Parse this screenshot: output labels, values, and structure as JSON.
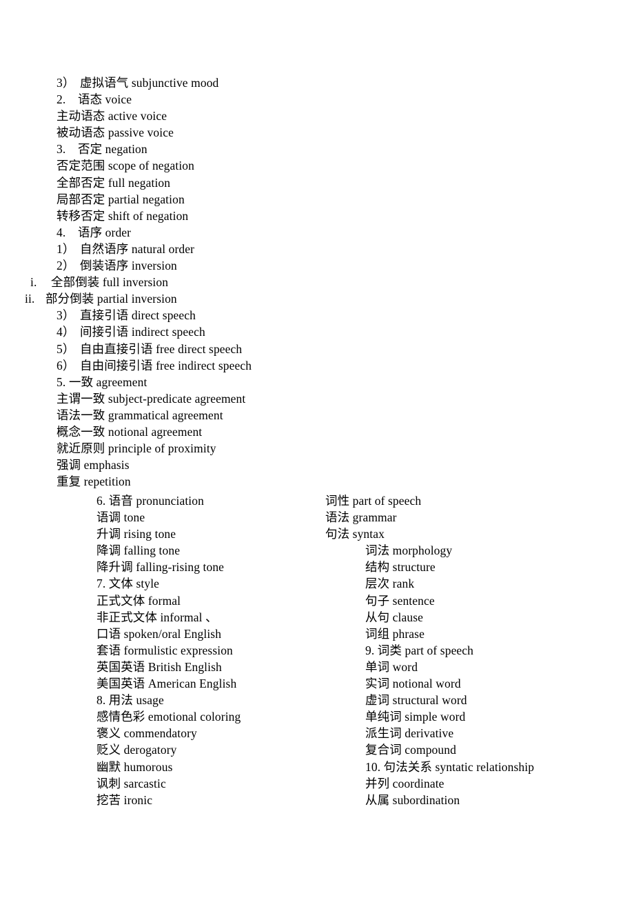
{
  "document": {
    "title": "Grammar Terminology Outline",
    "page_background": "#ffffff",
    "text_color": "#000000"
  },
  "outline_top": [
    {
      "marker": "3）",
      "text": "虚拟语气 subjunctive mood",
      "indent": "paren"
    },
    {
      "marker": "2.",
      "text": "语态 voice",
      "indent": "num"
    },
    {
      "marker": "",
      "text": "主动语态 active voice",
      "indent": "plain"
    },
    {
      "marker": "",
      "text": "被动语态 passive voice",
      "indent": "plain"
    },
    {
      "marker": "3.",
      "text": "否定 negation",
      "indent": "num"
    },
    {
      "marker": "",
      "text": "否定范围 scope of negation",
      "indent": "plain"
    },
    {
      "marker": "",
      "text": "全部否定 full negation",
      "indent": "plain"
    },
    {
      "marker": "",
      "text": "局部否定 partial negation",
      "indent": "plain"
    },
    {
      "marker": "",
      "text": "转移否定 shift of negation",
      "indent": "plain"
    },
    {
      "marker": "4.",
      "text": "语序 order",
      "indent": "num"
    },
    {
      "marker": "1）",
      "text": "自然语序 natural order",
      "indent": "paren"
    },
    {
      "marker": "2）",
      "text": "倒装语序 inversion",
      "indent": "paren"
    },
    {
      "marker": "i.",
      "text": "全部倒装 full inversion",
      "indent": "roman-i"
    },
    {
      "marker": "ii.",
      "text": "部分倒装 partial inversion",
      "indent": "roman-ii"
    },
    {
      "marker": "3）",
      "text": "直接引语 direct speech",
      "indent": "paren"
    },
    {
      "marker": "4）",
      "text": "间接引语 indirect speech",
      "indent": "paren"
    },
    {
      "marker": "5）",
      "text": "自由直接引语 free direct speech",
      "indent": "paren"
    },
    {
      "marker": "6）",
      "text": "自由间接引语 free indirect speech",
      "indent": "paren"
    },
    {
      "marker": "5.",
      "text": "一致 agreement",
      "indent": "num-tight"
    },
    {
      "marker": "",
      "text": "主谓一致 subject-predicate agreement",
      "indent": "plain"
    },
    {
      "marker": "",
      "text": "语法一致 grammatical agreement",
      "indent": "plain"
    },
    {
      "marker": "",
      "text": "概念一致 notional agreement",
      "indent": "plain"
    },
    {
      "marker": "",
      "text": "就近原则 principle of proximity",
      "indent": "plain"
    },
    {
      "marker": "",
      "text": "强调 emphasis",
      "indent": "plain"
    },
    {
      "marker": "",
      "text": "重复 repetition",
      "indent": "plain"
    }
  ],
  "column_left": [
    {
      "text": "6. 语音 pronunciation",
      "indent": false
    },
    {
      "text": "语调 tone",
      "indent": false
    },
    {
      "text": "升调 rising tone",
      "indent": false
    },
    {
      "text": "降调 falling tone",
      "indent": false
    },
    {
      "text": "降升调 falling-rising tone",
      "indent": false
    },
    {
      "text": "7. 文体 style",
      "indent": false
    },
    {
      "text": "正式文体 formal",
      "indent": false
    },
    {
      "text": "非正式文体 informal 、",
      "indent": false
    },
    {
      "text": "口语 spoken/oral English",
      "indent": false
    },
    {
      "text": "套语 formulistic expression",
      "indent": false
    },
    {
      "text": "英国英语 British English",
      "indent": false
    },
    {
      "text": "美国英语 American English",
      "indent": false
    },
    {
      "text": "8. 用法 usage",
      "indent": false
    },
    {
      "text": "感情色彩 emotional coloring",
      "indent": false
    },
    {
      "text": "褒义 commendatory",
      "indent": false
    },
    {
      "text": "贬义 derogatory",
      "indent": false
    },
    {
      "text": "幽默 humorous",
      "indent": false
    },
    {
      "text": "讽刺 sarcastic",
      "indent": false
    },
    {
      "text": "挖苦 ironic",
      "indent": false
    }
  ],
  "column_right": [
    {
      "text": "词性 part of speech",
      "indent": false
    },
    {
      "text": "语法 grammar",
      "indent": false
    },
    {
      "text": "句法 syntax",
      "indent": false
    },
    {
      "text": "词法 morphology",
      "indent": true
    },
    {
      "text": "结构 structure",
      "indent": true
    },
    {
      "text": "层次 rank",
      "indent": true
    },
    {
      "text": "句子 sentence",
      "indent": true
    },
    {
      "text": "从句 clause",
      "indent": true
    },
    {
      "text": "词组 phrase",
      "indent": true
    },
    {
      "text": "9. 词类 part of speech",
      "indent": true
    },
    {
      "text": "单词 word",
      "indent": true
    },
    {
      "text": "实词 notional word",
      "indent": true
    },
    {
      "text": "虚词 structural word",
      "indent": true
    },
    {
      "text": "单纯词 simple word",
      "indent": true
    },
    {
      "text": "派生词 derivative",
      "indent": true
    },
    {
      "text": "复合词 compound",
      "indent": true
    },
    {
      "text": "10. 句法关系 syntatic relationship",
      "indent": true
    },
    {
      "text": "并列 coordinate",
      "indent": true
    },
    {
      "text": "从属 subordination",
      "indent": true
    }
  ]
}
